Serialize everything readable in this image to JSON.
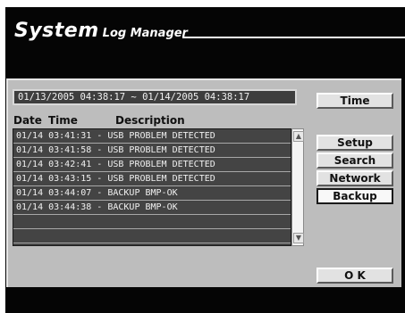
{
  "title": {
    "main": "System",
    "sub": "Log Manager"
  },
  "date_range": "01/13/2005  04:38:17 ~ 01/14/2005  04:38:17",
  "buttons": {
    "time": "Time",
    "setup": "Setup",
    "search": "Search",
    "network": "Network",
    "backup": "Backup",
    "ok": "O K"
  },
  "columns": {
    "date": "Date",
    "time": "Time",
    "description": "Description"
  },
  "log_rows": [
    "01/14 03:41:31 - USB PROBLEM DETECTED",
    "01/14 03:41:58 - USB PROBLEM DETECTED",
    "01/14 03:42:41 - USB PROBLEM DETECTED",
    "01/14 03:43:15 - USB PROBLEM DETECTED",
    "01/14 03:44:07 - BACKUP BMP-OK",
    "01/14 03:44:38 - BACKUP BMP-OK",
    "",
    ""
  ],
  "active_menu": "Backup",
  "colors": {
    "frame": "#050505",
    "panel": "#bdbdbd",
    "list_bg": "#444444",
    "button": "#e2e2e2",
    "text_light": "#f0f0f0"
  },
  "icons": {
    "scroll_up": "scroll-up-arrow-icon",
    "scroll_down": "scroll-down-arrow-icon"
  }
}
